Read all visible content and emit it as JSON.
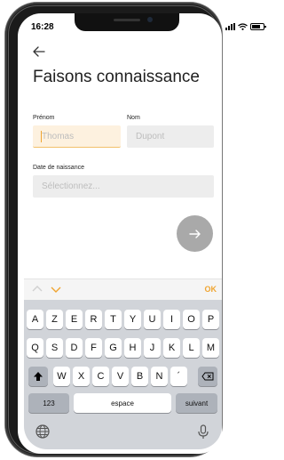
{
  "status_bar": {
    "time": "16:28"
  },
  "header": {
    "title": "Faisons connaissance"
  },
  "form": {
    "first_name": {
      "label": "Prénom",
      "placeholder": "Thomas",
      "value": ""
    },
    "last_name": {
      "label": "Nom",
      "placeholder": "Dupont",
      "value": ""
    },
    "birth_date": {
      "label": "Date de naissance",
      "placeholder": "Sélectionnez..."
    }
  },
  "accessory_bar": {
    "done_label": "OK"
  },
  "keyboard": {
    "row1": [
      "A",
      "Z",
      "E",
      "R",
      "T",
      "Y",
      "U",
      "I",
      "O",
      "P"
    ],
    "row2": [
      "Q",
      "S",
      "D",
      "F",
      "G",
      "H",
      "J",
      "K",
      "L",
      "M"
    ],
    "row3": [
      "W",
      "X",
      "C",
      "V",
      "B",
      "N",
      "´"
    ],
    "numbers_label": "123",
    "space_label": "espace",
    "return_label": "suivant"
  },
  "colors": {
    "accent": "#f0a531",
    "active_field_bg": "#fdf1df",
    "field_bg": "#ededed",
    "next_button_bg": "#a9a9a9",
    "keyboard_bg": "#d1d4d9"
  },
  "icons": {
    "back": "arrow-left-icon",
    "next": "arrow-right-icon",
    "prev_field": "chevron-up-icon",
    "next_field": "chevron-down-icon",
    "shift": "shift-icon",
    "delete": "backspace-icon",
    "globe": "globe-icon",
    "mic": "microphone-icon"
  }
}
